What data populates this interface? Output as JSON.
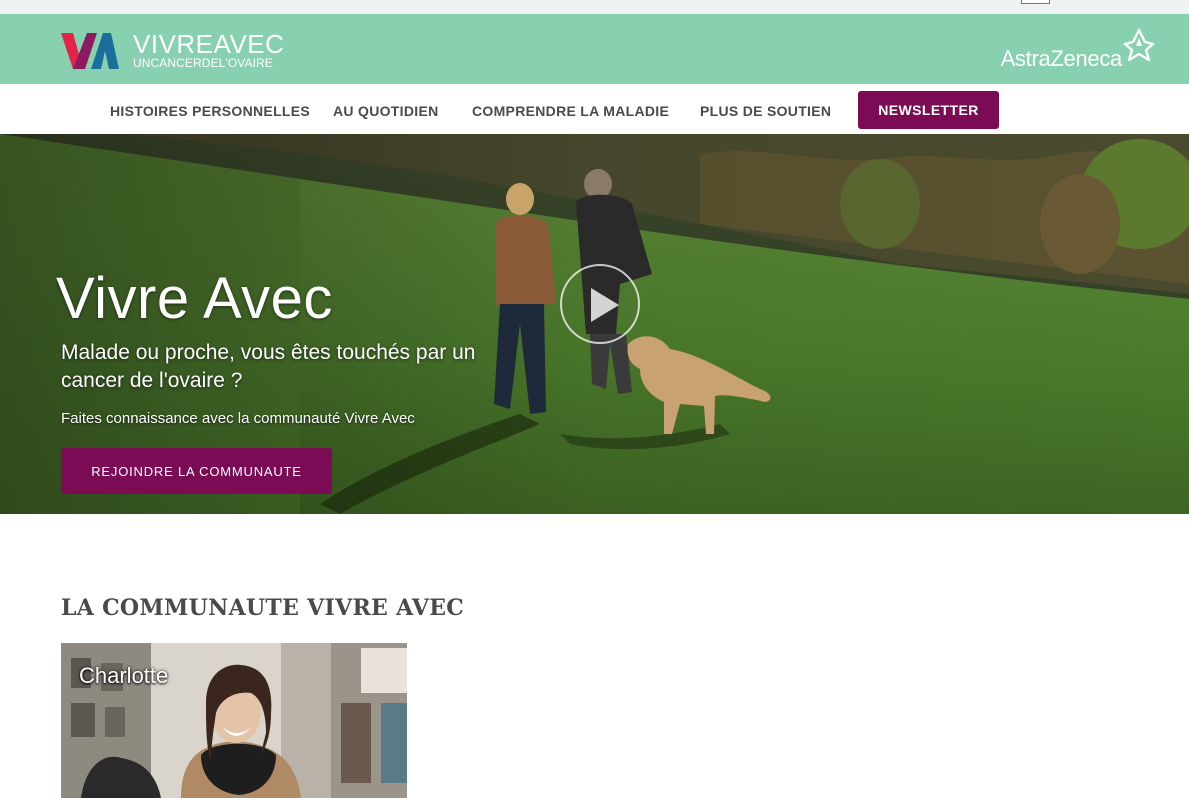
{
  "brand": {
    "logo_line1": "VIVREAVEC",
    "logo_line2": "UNCANCERDEL'OVAIRE",
    "partner": "AstraZeneca",
    "colors": {
      "header_bg": "#88d1b0",
      "accent": "#7c0b55"
    }
  },
  "nav": {
    "items": [
      {
        "label": "HISTOIRES PERSONNELLES"
      },
      {
        "label": "AU QUOTIDIEN"
      },
      {
        "label": "COMPRENDRE LA MALADIE"
      },
      {
        "label": "PLUS DE SOUTIEN"
      }
    ],
    "newsletter_label": "NEWSLETTER"
  },
  "hero": {
    "title": "Vivre Avec",
    "subtitle": "Malade ou proche, vous êtes touchés par un cancer de l'ovaire ?",
    "tagline": "Faites connaissance avec la communauté Vivre Avec",
    "cta_label": "REJOINDRE LA COMMUNAUTE",
    "play_icon": "play-icon"
  },
  "community": {
    "title": "LA COMMUNAUTE VIVRE AVEC",
    "cards": [
      {
        "name": "Charlotte"
      }
    ]
  }
}
